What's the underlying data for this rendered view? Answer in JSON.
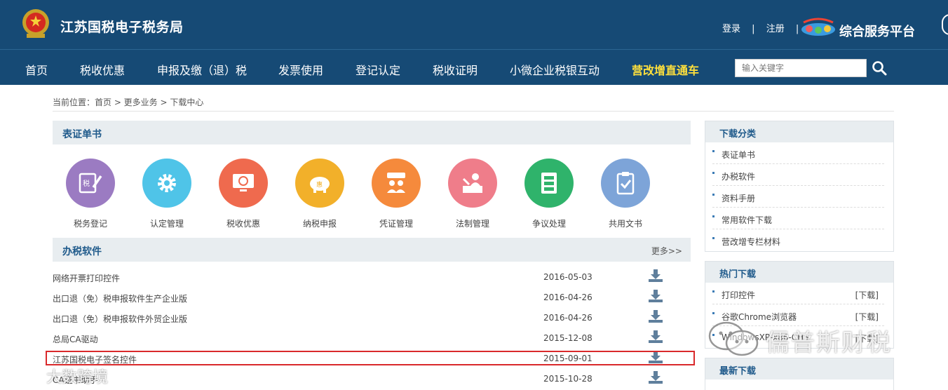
{
  "header": {
    "site_title": "江苏国税电子税务局",
    "login": "登录",
    "separator": "|",
    "register": "注册",
    "platform_text": "综合服务平台",
    "bg_color": "#164a75"
  },
  "nav": {
    "items": [
      "首页",
      "税收优惠",
      "申报及缴（退）税",
      "发票使用",
      "登记认定",
      "税收证明",
      "小微企业税银互动",
      "营改增直通车"
    ],
    "highlight_color": "#ffe03c",
    "search_placeholder": "输入关键字"
  },
  "breadcrumb": "当前位置：首页 > 更多业务 > 下载中心",
  "forms_section": {
    "title": "表证单书",
    "categories": [
      {
        "label": "税务登记",
        "color": "#9b7bc2",
        "icon": "tax-register-icon"
      },
      {
        "label": "认定管理",
        "color": "#4fc4e8",
        "icon": "gear-icon"
      },
      {
        "label": "税收优惠",
        "color": "#ef6a4e",
        "icon": "monitor-icon"
      },
      {
        "label": "纳税申报",
        "color": "#f2b02a",
        "icon": "piggy-bank-icon"
      },
      {
        "label": "凭证管理",
        "color": "#f58a3c",
        "icon": "people-icon"
      },
      {
        "label": "法制管理",
        "color": "#ef7d8a",
        "icon": "judge-icon"
      },
      {
        "label": "争议处理",
        "color": "#2fb36b",
        "icon": "cabinet-icon"
      },
      {
        "label": "共用文书",
        "color": "#7da4d8",
        "icon": "clipboard-icon"
      }
    ]
  },
  "software_section": {
    "title": "办税软件",
    "more": "更多>>",
    "rows": [
      {
        "name": "网络开票打印控件",
        "date": "2016-05-03"
      },
      {
        "name": "出口退（免）税申报软件生产企业版",
        "date": "2016-04-26"
      },
      {
        "name": "出口退（免）税申报软件外贸企业版",
        "date": "2016-04-26"
      },
      {
        "name": "总局CA驱动",
        "date": "2015-12-08"
      },
      {
        "name": "江苏国税电子签名控件",
        "date": "2015-09-01"
      },
      {
        "name": "CA证书助手",
        "date": "2015-10-28"
      }
    ]
  },
  "right_panels": {
    "categories": {
      "title": "下载分类",
      "items": [
        "表证单书",
        "办税软件",
        "资料手册",
        "常用软件下载",
        "营改增专栏材料"
      ]
    },
    "hot": {
      "title": "热门下载",
      "tag": "[下载]",
      "items": [
        "打印控件",
        "谷歌Chrome浏览器",
        "WindowsXP-x86-CHS"
      ]
    },
    "latest": {
      "title": "最新下载"
    }
  },
  "watermarks": {
    "right": "儒普斯财税",
    "left": "大数跨境"
  },
  "colors": {
    "accent_blue": "#1f5a8b",
    "highlight_red": "#d9292b"
  }
}
